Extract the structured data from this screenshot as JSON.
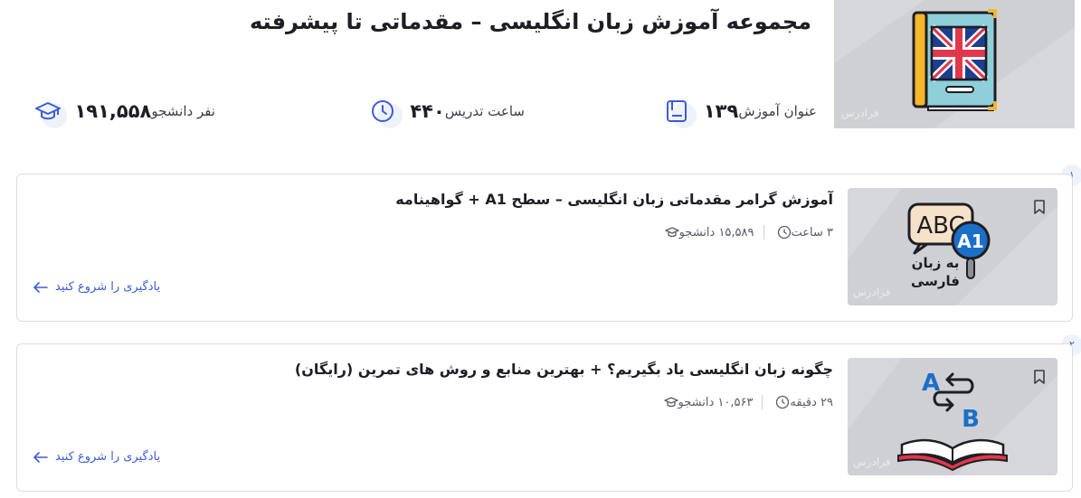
{
  "header": {
    "title": "مجموعه آموزش زبان انگلیسی – مقدماتی تا پیشرفته",
    "thumb_watermark": "فرادرس",
    "stats": [
      {
        "icon": "lessons-icon",
        "value": "۱۳۹",
        "label": "عنوان آموزش"
      },
      {
        "icon": "clock-icon",
        "value": "۴۴۰",
        "label": "ساعت تدریس"
      },
      {
        "icon": "graduation-cap-icon",
        "value": "۱۹۱,۵۵۸",
        "label": "نفر دانشجو"
      }
    ]
  },
  "courses": [
    {
      "index": "۱",
      "title": "آموزش گرامر مقدماتی زبان انگلیسی – سطح A1 + گواهینامه",
      "students": "۱۵,۵۸۹ دانشجو",
      "duration": "۳ ساعت",
      "start_label": "یادگیری را شروع کنید",
      "thumb_text": {
        "abc": "ABC",
        "level": "A1",
        "line1": "به زبان",
        "line2": "فارسی"
      },
      "thumb_watermark": "فرادرس"
    },
    {
      "index": "۲",
      "title": "چگونه زبان انگلیسی یاد بگیریم؟ + بهترین منابع و روش های تمرین (رایگان)",
      "students": "۱۰,۵۶۳ دانشجو",
      "duration": "۲۹ دقیقه",
      "start_label": "یادگیری را شروع کنید",
      "thumb_text": {
        "a": "A",
        "b": "B"
      },
      "thumb_watermark": "فرادرس"
    }
  ],
  "colors": {
    "accent": "#3b5bd6",
    "text": "#1e1e24",
    "muted": "#5a5a63",
    "thumb_bg": "#d6d7da",
    "border": "#dcdde0",
    "book_cover": "#8ecfd9",
    "flag_blue": "#1c3f8f",
    "flag_red": "#e0384b",
    "flag_gold": "#f5b62b"
  }
}
